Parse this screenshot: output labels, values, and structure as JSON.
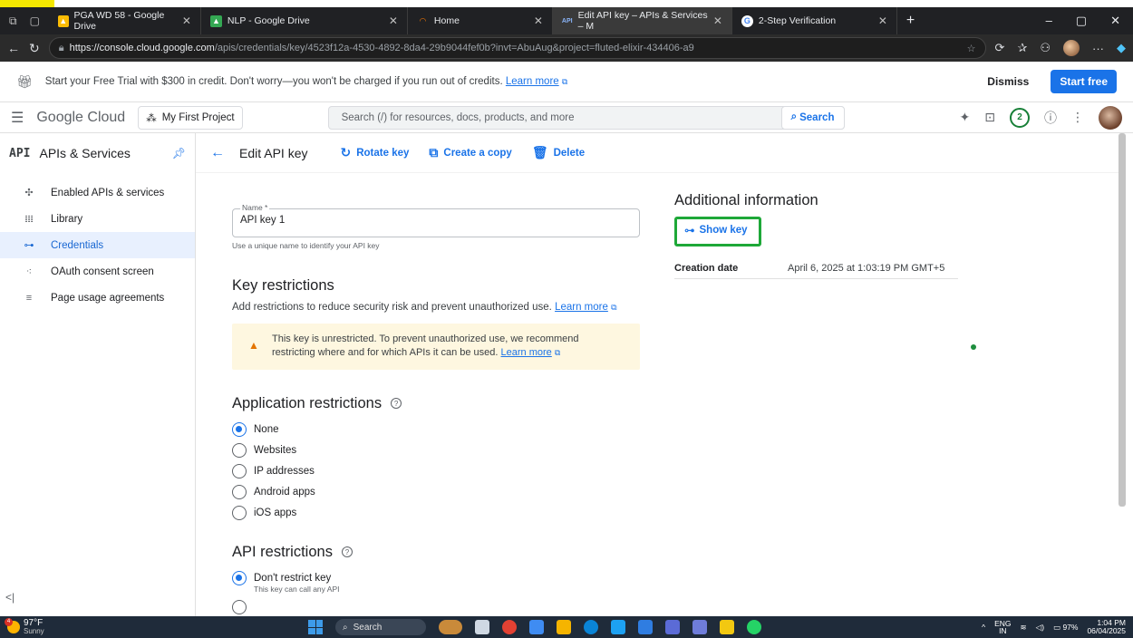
{
  "browser": {
    "tabs": [
      {
        "title": "PGA WD 58 - Google Drive",
        "favicon": "drive-icon"
      },
      {
        "title": "NLP - Google Drive",
        "favicon": "drive-icon"
      },
      {
        "title": "Home",
        "favicon": "home-icon"
      },
      {
        "title": "Edit API key – APIs & Services – M",
        "favicon": "api-icon",
        "active": true
      },
      {
        "title": "2-Step Verification",
        "favicon": "google-icon"
      }
    ],
    "url_host": "https://console.cloud.google.com",
    "url_path": "/apis/credentials/key/4523f12a-4530-4892-8da4-29b9044fef0b?invt=AbuAug&project=fluted-elixir-434406-a9"
  },
  "trial_banner": {
    "message": "Start your Free Trial with $300 in credit. Don't worry—you won't be charged if you run out of credits.",
    "learn_more": "Learn more",
    "dismiss": "Dismiss",
    "start_free": "Start free"
  },
  "header": {
    "brand": "Google Cloud",
    "project": "My First Project",
    "search_placeholder": "Search (/) for resources, docs, products, and more",
    "search_button": "Search",
    "notification_count": "2"
  },
  "sidebar": {
    "title_mark": "API",
    "title": "APIs & Services",
    "items": [
      {
        "label": "Enabled APIs & services",
        "icon": "hub-icon"
      },
      {
        "label": "Library",
        "icon": "library-icon"
      },
      {
        "label": "Credentials",
        "icon": "key-icon",
        "active": true
      },
      {
        "label": "OAuth consent screen",
        "icon": "oauth-icon"
      },
      {
        "label": "Page usage agreements",
        "icon": "agreements-icon"
      }
    ]
  },
  "toolbar": {
    "title": "Edit API key",
    "rotate": "Rotate key",
    "copy": "Create a copy",
    "delete": "Delete"
  },
  "form": {
    "name_label": "Name *",
    "name_value": "API key 1",
    "name_hint": "Use a unique name to identify your API key",
    "key_restrictions_title": "Key restrictions",
    "key_restrictions_desc": "Add restrictions to reduce security risk and prevent unauthorized use.",
    "learn_more": "Learn more",
    "warning_line1": "This key is unrestricted. To prevent unauthorized use, we recommend",
    "warning_line2": "restricting where and for which APIs it can be used.",
    "app_restrictions_title": "Application restrictions",
    "app_options": [
      "None",
      "Websites",
      "IP addresses",
      "Android apps",
      "iOS apps"
    ],
    "app_selected": "None",
    "api_restrictions_title": "API restrictions",
    "api_option_1": "Don't restrict key",
    "api_option_1_sub": "This key can call any API"
  },
  "info": {
    "title": "Additional information",
    "show_key": "Show key",
    "creation_label": "Creation date",
    "creation_value": "April 6, 2025 at 1:03:19 PM GMT+5"
  },
  "taskbar": {
    "temperature": "97°F",
    "weather": "Sunny",
    "weather_badge": "4",
    "search": "Search",
    "lang": "ENG",
    "region": "IN",
    "battery": "97%",
    "time": "1:04 PM",
    "date": "06/04/2025"
  }
}
